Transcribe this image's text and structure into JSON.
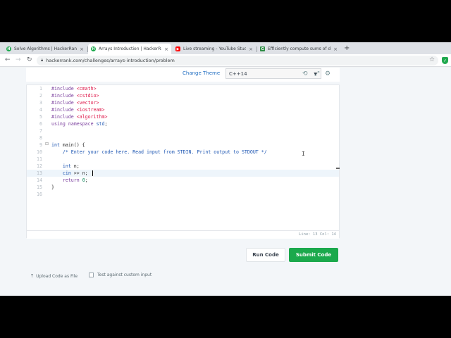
{
  "browser": {
    "tabs": [
      {
        "label": "Solve Algorithms | HackerRank",
        "favicon": "hackerrank-icon",
        "color": "#1ba94c",
        "active": false
      },
      {
        "label": "Arrays Introduction | HackerRank",
        "favicon": "hackerrank-icon",
        "color": "#1ba94c",
        "active": true
      },
      {
        "label": "Live streaming - YouTube Studio",
        "favicon": "youtube-icon",
        "color": "#ff0000",
        "active": false
      },
      {
        "label": "Efficiently compute sums of diag...",
        "favicon": "geeksforgeeks-icon",
        "color": "#2f8d46",
        "active": false
      }
    ],
    "close_glyph": "×",
    "new_tab_glyph": "+",
    "url": "hackerrank.com/challenges/arrays-introduction/problem"
  },
  "editor": {
    "change_theme": "Change Theme",
    "language": "C++14",
    "code_lines": [
      {
        "num": "1",
        "text": "#include <cmath>"
      },
      {
        "num": "2",
        "text": "#include <cstdio>"
      },
      {
        "num": "3",
        "text": "#include <vector>"
      },
      {
        "num": "4",
        "text": "#include <iostream>"
      },
      {
        "num": "5",
        "text": "#include <algorithm>"
      },
      {
        "num": "6",
        "text": "using namespace std;"
      },
      {
        "num": "7",
        "text": ""
      },
      {
        "num": "8",
        "text": ""
      },
      {
        "num": "9",
        "text": "int main() {"
      },
      {
        "num": "10",
        "text": "    /* Enter your code here. Read input from STDIN. Print output to STDOUT */"
      },
      {
        "num": "11",
        "text": ""
      },
      {
        "num": "12",
        "text": "    int n;"
      },
      {
        "num": "13",
        "text": "    cin >> n;"
      },
      {
        "num": "14",
        "text": "    return 0;"
      },
      {
        "num": "15",
        "text": "}"
      },
      {
        "num": "16",
        "text": ""
      }
    ],
    "cursor_position": "Line: 13 Col: 14"
  },
  "actions": {
    "upload": "Upload Code as File",
    "custom_input": "Test against custom input",
    "run": "Run Code",
    "submit": "Submit Code"
  },
  "colors": {
    "submit_green": "#1ba94c",
    "link_blue": "#1f6dc1"
  }
}
